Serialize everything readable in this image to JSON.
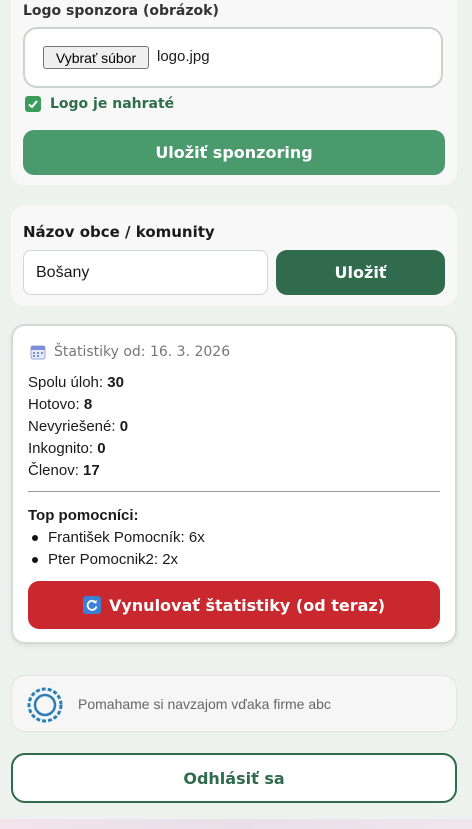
{
  "sponsor": {
    "logo_label": "Logo sponzora (obrázok)",
    "file_button": "Vybrať súbor",
    "file_name": "logo.jpg",
    "uploaded_text": "Logo je nahraté",
    "save_button": "Uložiť sponzoring"
  },
  "community": {
    "label": "Názov obce / komunity",
    "value": "Bošany",
    "save_button": "Uložiť"
  },
  "stats": {
    "since": "Štatistiky od: 16. 3. 2026",
    "total_label": "Spolu úloh:",
    "total": "30",
    "done_label": "Hotovo:",
    "done": "8",
    "unresolved_label": "Nevyriešené:",
    "unresolved": "0",
    "incognito_label": "Inkognito:",
    "incognito": "0",
    "members_label": "Členov:",
    "members": "17",
    "top_label": "Top pomocníci:",
    "helpers": [
      "František Pomocník: 6x",
      "Pter Pomocnik2: 2x"
    ],
    "reset_button": "Vynulovať štatistiky (od teraz)"
  },
  "footer": {
    "sponsor_text": "Pomahame si navzajom vďaka firme abc",
    "logout_button": "Odhlásiť sa"
  },
  "colors": {
    "green": "#4a9a6e",
    "dark_green": "#2f6b4c",
    "red": "#c9282f"
  }
}
